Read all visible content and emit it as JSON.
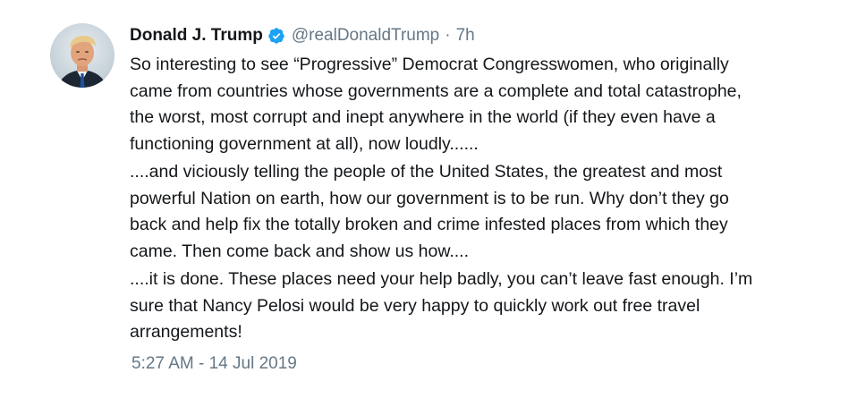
{
  "tweet": {
    "display_name": "Donald J. Trump",
    "handle": "@realDonaldTrump",
    "separator": "·",
    "time_ago": "7h",
    "verified_icon": "verified-badge-icon",
    "avatar_icon": "profile-photo",
    "paragraphs": [
      "So interesting to see “Progressive” Democrat Congresswomen, who originally\ncame from countries whose governments are a complete and total catastrophe,\nthe worst, most corrupt and inept anywhere in the world (if they even have a\nfunctioning government at all), now loudly......",
      "....and viciously telling the people of the United States, the greatest and most\npowerful Nation on earth, how our government is to be run. Why don’t they go\nback and help fix the totally broken and crime infested places from which they\ncame. Then come back and show us how....",
      "....it is done. These places need your help badly, you can’t leave fast enough. I’m\nsure that Nancy Pelosi would be very happy to quickly work out free travel\narrangements!"
    ],
    "timestamp": "5:27 AM - 14 Jul 2019"
  },
  "colors": {
    "text": "#14171a",
    "muted": "#657786",
    "verified_blue": "#1da1f2"
  }
}
